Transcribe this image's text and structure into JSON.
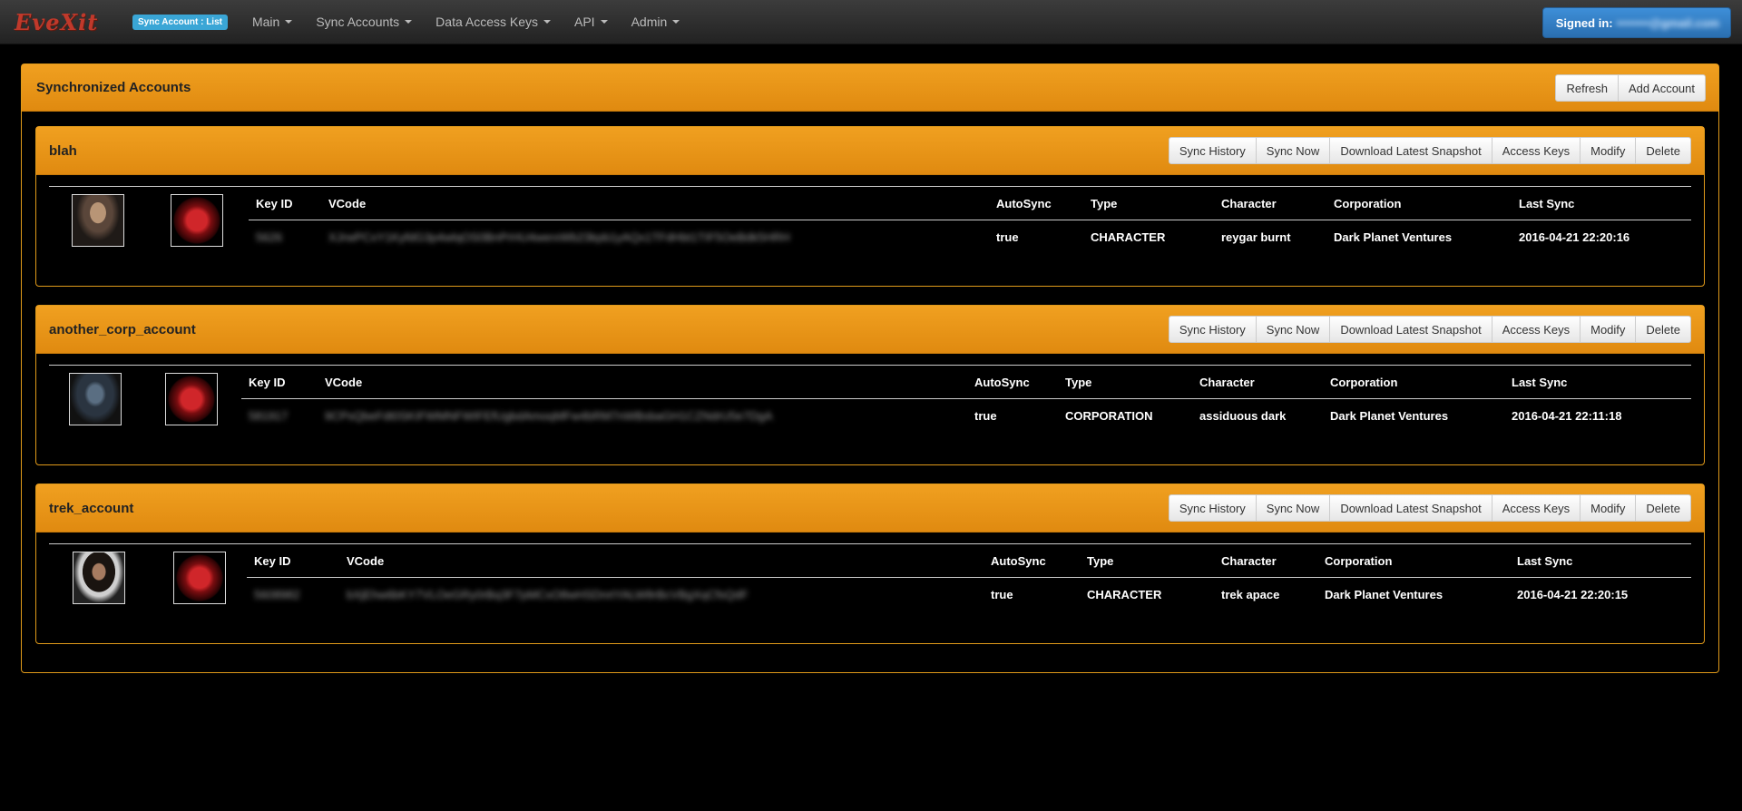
{
  "navbar": {
    "brand": "EveXit",
    "page_badge": "Sync Account : List",
    "menu": [
      {
        "label": "Main"
      },
      {
        "label": "Sync Accounts"
      },
      {
        "label": "Data Access Keys"
      },
      {
        "label": "API"
      },
      {
        "label": "Admin"
      }
    ],
    "signed_in_label": "Signed in:",
    "signed_in_email": "••••••••@gmail.com"
  },
  "panel": {
    "title": "Synchronized Accounts",
    "refresh_label": "Refresh",
    "add_label": "Add Account"
  },
  "account_actions": {
    "sync_history": "Sync History",
    "sync_now": "Sync Now",
    "download": "Download Latest Snapshot",
    "access_keys": "Access Keys",
    "modify": "Modify",
    "delete": "Delete"
  },
  "table_headers": {
    "key_id": "Key ID",
    "vcode": "VCode",
    "autosync": "AutoSync",
    "type": "Type",
    "character": "Character",
    "corporation": "Corporation",
    "last_sync": "Last Sync"
  },
  "accounts": [
    {
      "name": "blah",
      "key_id": "5626",
      "vcode": "XJrwPCxY1KyfdG3p4wlqOS0BnPrHU4werxWb23kpb1yAQx1TFdHbt1TIF5OeBdk5HRH",
      "autosync": "true",
      "type": "CHARACTER",
      "character": "reygar burnt",
      "corporation": "Dark Planet Ventures",
      "last_sync": "2016-04-21 22:20:16"
    },
    {
      "name": "another_corp_account",
      "key_id": "581917",
      "vcode": "9CPsQbeFdt0SKIFWMNFWIFEfUgbdAmoqMFw4bRM7nWBsbaGH1CZNdrU5e7DgA",
      "autosync": "true",
      "type": "CORPORATION",
      "character": "assiduous dark",
      "corporation": "Dark Planet Ventures",
      "last_sync": "2016-04-21 22:11:18"
    },
    {
      "name": "trek_account",
      "key_id": "5608982",
      "vcode": "bXjEhw6bKY7VLOeGRy0rBq3F7pMCxO8wHSDnrtYALW8rBcVBgXqCfsQdF",
      "autosync": "true",
      "type": "CHARACTER",
      "character": "trek apace",
      "corporation": "Dark Planet Ventures",
      "last_sync": "2016-04-21 22:20:15"
    }
  ]
}
